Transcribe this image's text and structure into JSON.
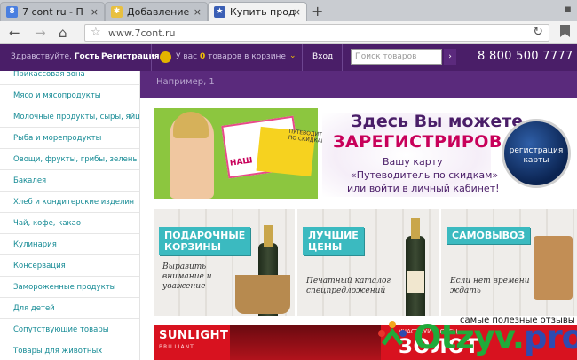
{
  "browser": {
    "tabs": [
      {
        "title": "7 cont ru - П",
        "favicon": "google-favicon",
        "color": "#4a7fe0"
      },
      {
        "title": "Добавление",
        "favicon": "pinwheel-favicon",
        "color": "#e0a020"
      },
      {
        "title": "Купить прод",
        "favicon": "7cont-favicon",
        "color": "#3b5fb5"
      }
    ],
    "new_tab": "+",
    "url": "www.7cont.ru"
  },
  "header": {
    "greeting": "Здравствуйте,",
    "user": "Гость",
    "register": "Регистрация",
    "cart_prefix": "У вас",
    "cart_count": "0",
    "cart_suffix": "товаров в корзине",
    "login": "Вход",
    "search_placeholder": "Поиск товаров",
    "phone": "8 800 500 7777"
  },
  "sidebar": {
    "items": [
      {
        "label": "Прикассовая зона"
      },
      {
        "label": "Мясо и мясопродукты"
      },
      {
        "label": "Молочные продукты, сыры, яйца"
      },
      {
        "label": "Рыба и морепродукты"
      },
      {
        "label": "Овощи, фрукты, грибы, зелень"
      },
      {
        "label": "Бакалея"
      },
      {
        "label": "Хлеб и кондитерские изделия"
      },
      {
        "label": "Чай, кофе, какао"
      },
      {
        "label": "Кулинария"
      },
      {
        "label": "Консервация"
      },
      {
        "label": "Замороженные продукты"
      },
      {
        "label": "Для детей"
      },
      {
        "label": "Сопутствующие товары"
      },
      {
        "label": "Товары для животных"
      }
    ]
  },
  "main": {
    "search_hint": "Например, 1",
    "banner": {
      "line1": "Здесь Вы можете",
      "line2": "ЗАРЕГИСТРИРОВАТЬ",
      "line3": "Вашу карту",
      "line4": "«Путеводитель по скидкам»",
      "line5": "или войти в личный кабинет!",
      "card_text": "ПУТЕВОДИТЕЛЬ ПО СКИДКАМ",
      "card_brand": "НАШ",
      "button_line1": "регистрация",
      "button_line2": "карты"
    },
    "promos": [
      {
        "tag_line1": "ПОДАРОЧНЫЕ",
        "tag_line2": "КОРЗИНЫ",
        "script_line1": "Выразить",
        "script_line2": "внимание и",
        "script_line3": "уважение"
      },
      {
        "tag_line1": "ЛУЧШИЕ",
        "tag_line2": "ЦЕНЫ",
        "script_line1": "Печатный каталог",
        "script_line2": "спецпредложений"
      },
      {
        "tag_line1": "САМОВЫВОЗ",
        "tag_line2": "",
        "script_line1": "Если нет времени",
        "script_line2": "ждать"
      }
    ],
    "sunlight": {
      "logo": "SUNLIGHT",
      "sub": "BRILLIANT",
      "participate": "УЧАСТВУЙ В СПЕЦ",
      "gold": "ЗОЛОТ"
    }
  },
  "watermark": {
    "caption": "самые полезные отзывы",
    "logo_main": "Otzyv.",
    "logo_pro": "pro"
  }
}
